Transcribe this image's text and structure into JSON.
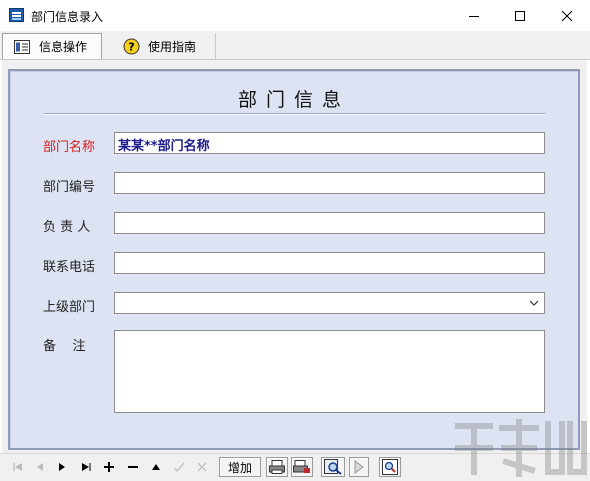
{
  "window": {
    "title": "部门信息录入",
    "controls": [
      "minimize-icon",
      "maximize-icon",
      "close-icon"
    ]
  },
  "tabs": [
    {
      "label": "信息操作",
      "icon": "info-list-icon",
      "active": true
    },
    {
      "label": "使用指南",
      "icon": "help-icon",
      "active": false
    }
  ],
  "form": {
    "title": "部门信息",
    "fields": {
      "dept_name": {
        "label": "部门名称",
        "value": "某某**部门名称",
        "required": true
      },
      "dept_code": {
        "label": "部门编号",
        "value": ""
      },
      "manager": {
        "label": "负 责 人",
        "value": ""
      },
      "phone": {
        "label": "联系电话",
        "value": ""
      },
      "parent_dept": {
        "label": "上级部门",
        "value": ""
      },
      "remarks": {
        "label": "备    注",
        "value": ""
      }
    }
  },
  "toolbar": {
    "add_label": "增加",
    "icons": [
      "first-record-icon",
      "prev-record-icon",
      "next-record-icon",
      "last-record-icon",
      "insert-icon",
      "delete-icon",
      "up-icon",
      "confirm-icon",
      "cancel-icon",
      "print-icon",
      "print-preview-icon",
      "search-icon",
      "play-icon",
      "zoom-icon"
    ]
  },
  "colors": {
    "panel_bg": "#dde3f3",
    "required_label": "#d32020",
    "filled_value": "#1c1c8c"
  }
}
